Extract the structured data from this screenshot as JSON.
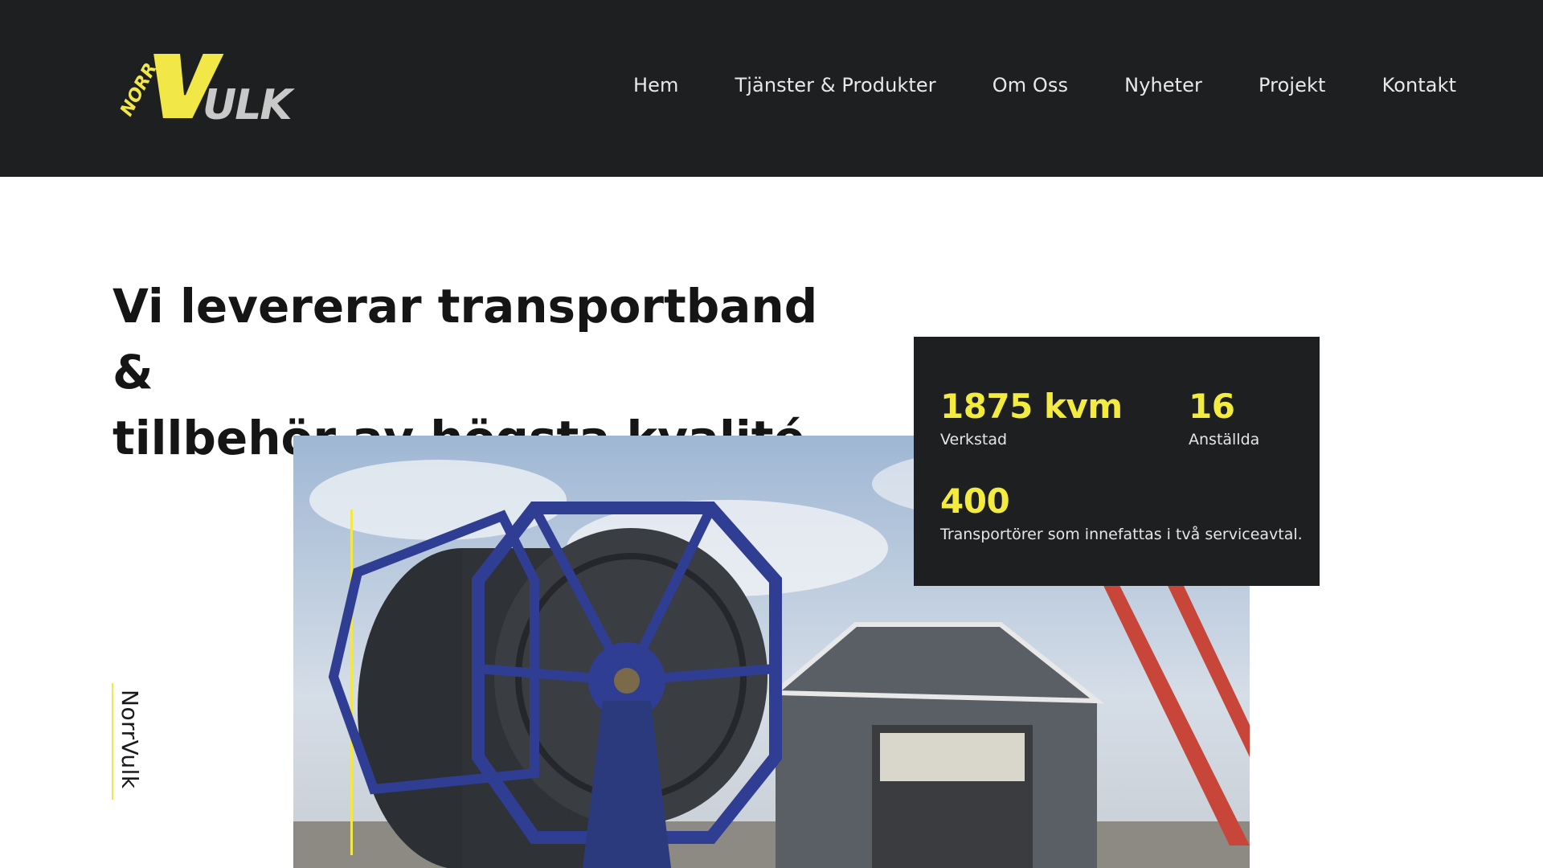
{
  "brand": {
    "logo_top": "NORR",
    "logo_main": "VULK",
    "logo_yellow": "#f1e746",
    "logo_gray": "#c9c9c9"
  },
  "nav": {
    "items": [
      {
        "label": "Hem"
      },
      {
        "label": "Tjänster & Produkter"
      },
      {
        "label": "Om Oss"
      },
      {
        "label": "Nyheter"
      },
      {
        "label": "Projekt"
      },
      {
        "label": "Kontakt"
      }
    ]
  },
  "hero": {
    "headline_line1": "Vi levererar transportband &",
    "headline_line2": "tillbehör av högsta kvalité.",
    "vertical_label": "NorrVulk",
    "accent_color": "#f1e746"
  },
  "stats": [
    {
      "value": "1875 kvm",
      "label": "Verkstad"
    },
    {
      "value": "16",
      "label": "Anställda"
    },
    {
      "value": "400",
      "label": "Transportörer som innefattas i två serviceavtal."
    }
  ],
  "colors": {
    "header_bg": "#1d1f20",
    "stat_value": "#f3ec3e"
  }
}
